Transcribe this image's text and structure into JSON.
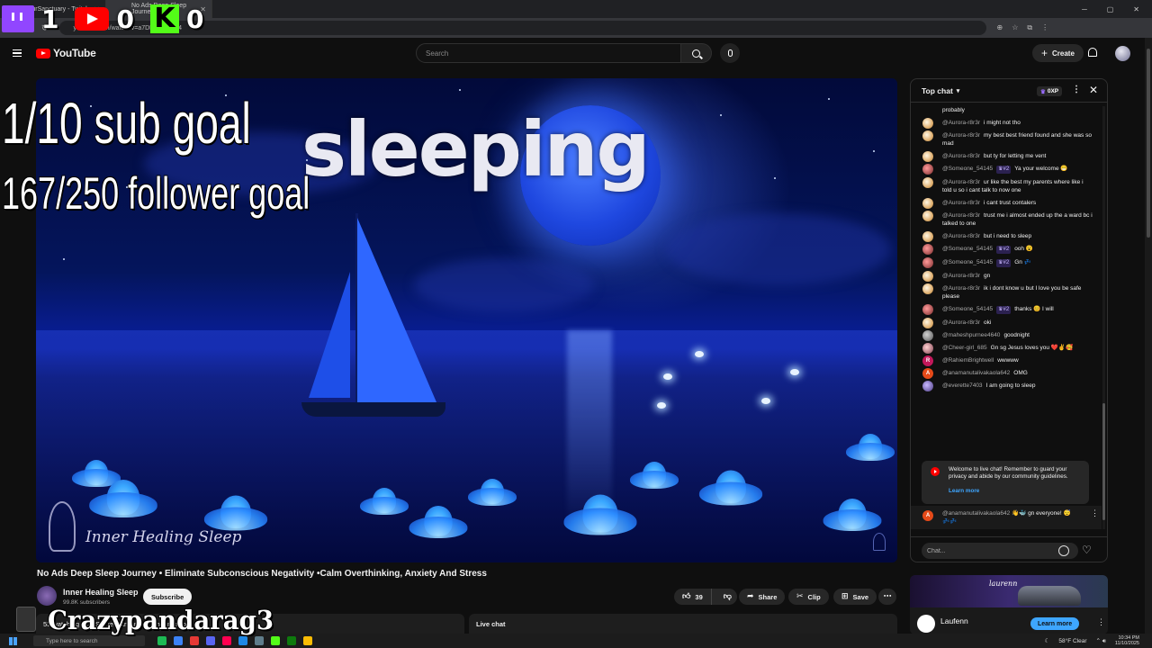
{
  "browser": {
    "tabs": [
      {
        "label": "yourSanctuary - Twitch"
      },
      {
        "label": "No Ads Deep Sleep Journey"
      }
    ],
    "url": "youtube.com/watch?v=a7DFel2HMJ44"
  },
  "overlay": {
    "twitch_count": "1",
    "youtube_count": "0",
    "kick_count": "0",
    "sub_goal": "1/10 sub goal",
    "follower_goal": "167/250 follower goal",
    "username": "Crazypandarag3"
  },
  "masthead": {
    "logo_text": "YouTube",
    "search_placeholder": "Search",
    "create_label": "Create"
  },
  "video": {
    "overlay_text": "sleeping",
    "watermark": "Inner Healing Sleep",
    "title": "No Ads Deep Sleep Journey • Eliminate Subconscious Negativity •Calm Overthinking, Anxiety And Stress",
    "channel": "Inner Healing Sleep",
    "subscribers": "99.8K subscribers",
    "subscribe_label": "Subscribe",
    "likes": "39",
    "share_label": "Share",
    "clip_label": "Clip",
    "save_label": "Save"
  },
  "bottom": {
    "left_text": "53 watching now  Started streaming 2 hours ago",
    "right_text": "Live chat"
  },
  "chat": {
    "header": "Top chat",
    "xp": "0XP",
    "messages": [
      {
        "author": "",
        "text": "probably",
        "avatar": "none"
      },
      {
        "author": "@Aurora-r8r3r",
        "text": "i might not tho",
        "avatar": "cat"
      },
      {
        "author": "@Aurora-r8r3r",
        "text": "my best best friend found and she was so mad",
        "avatar": "cat"
      },
      {
        "author": "@Aurora-r8r3r",
        "text": "but ty for letting me vent",
        "avatar": "cat"
      },
      {
        "author": "@Someone_54145",
        "badge": "♛#2",
        "text": "Ya your welcome 😁",
        "avatar": "red"
      },
      {
        "author": "@Aurora-r8r3r",
        "text": "ur like the best my parents where like i told u so i cant talk to now one",
        "avatar": "cat"
      },
      {
        "author": "@Aurora-r8r3r",
        "text": "i cant trust contalers",
        "avatar": "cat"
      },
      {
        "author": "@Aurora-r8r3r",
        "text": "trust me i almost ended up the a ward bc i talked to one",
        "avatar": "cat"
      },
      {
        "author": "@Aurora-r8r3r",
        "text": "but i need to sleep",
        "avatar": "cat"
      },
      {
        "author": "@Someone_54145",
        "badge": "♛#2",
        "text": "ooh 😮",
        "avatar": "red"
      },
      {
        "author": "@Someone_54145",
        "badge": "♛#2",
        "text": "Gn 💤",
        "avatar": "red"
      },
      {
        "author": "@Aurora-r8r3r",
        "text": "gn",
        "avatar": "cat"
      },
      {
        "author": "@Aurora-r8r3r",
        "text": "ik i dont know u but I love you be safe please",
        "avatar": "cat"
      },
      {
        "author": "@Someone_54145",
        "badge": "♛#2",
        "text": "thanks 😊 I will",
        "avatar": "red"
      },
      {
        "author": "@Aurora-r8r3r",
        "text": "oki",
        "avatar": "cat"
      },
      {
        "author": "@maheshpurnee4640",
        "text": "goodnight",
        "avatar": "grey"
      },
      {
        "author": "@Cheer-girl_685",
        "text": "Gn sg Jesus loves you ❤️✌️🥰",
        "avatar": "pink"
      },
      {
        "author": "@RahiemBrightwell",
        "text": "wwwww",
        "avatar": "letter-r"
      },
      {
        "author": "@anamanutalivakaola642",
        "text": "OMG",
        "avatar": "letter-a"
      },
      {
        "author": "@everette7403",
        "text": "I am going to sleep",
        "avatar": "purple"
      }
    ],
    "notice_text": "Welcome to live chat! Remember to guard your privacy and abide by our community guidelines.",
    "notice_link": "Learn more",
    "pinned_author": "@anamanutalivakaola642",
    "pinned_text": "👋🐳 gn everyone! 😴💤💤",
    "input_placeholder": "Chat..."
  },
  "ad": {
    "brand_small": "laurenn",
    "name": "Laufenn",
    "cta": "Learn more"
  },
  "taskbar": {
    "search_placeholder": "Type here to search",
    "weather": "58°F  Clear",
    "time": "10:34 PM",
    "date": "11/10/2025"
  }
}
